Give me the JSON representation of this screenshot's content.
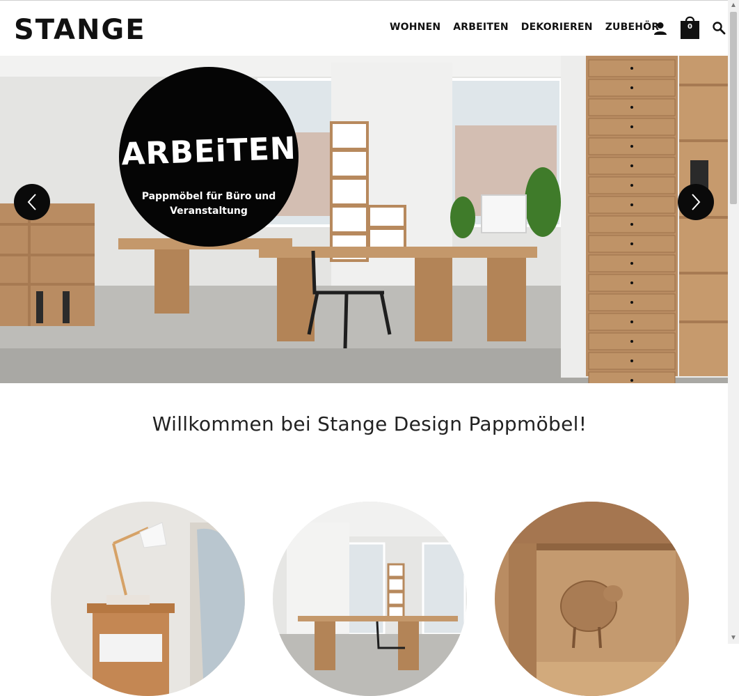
{
  "brand": {
    "name": "STANGE"
  },
  "nav": {
    "items": [
      {
        "label": "WOHNEN"
      },
      {
        "label": "ARBEITEN"
      },
      {
        "label": "DEKORIEREN"
      },
      {
        "label": "ZUBEHÖR"
      }
    ]
  },
  "header": {
    "user_icon": "user-icon",
    "cart_icon": "shopping-bag-icon",
    "cart_count": "0",
    "search_icon": "search-icon"
  },
  "hero": {
    "title": "ARBEiTEN",
    "subtitle": "Pappmöbel für Büro und Veranstaltung",
    "prev_icon": "chevron-left-icon",
    "next_icon": "chevron-right-icon"
  },
  "welcome": {
    "title": "Willkommen bei Stange Design Pappmöbel!"
  },
  "colors": {
    "accent": "#050505",
    "cardboard": "#b88a5e",
    "background": "#ffffff"
  }
}
